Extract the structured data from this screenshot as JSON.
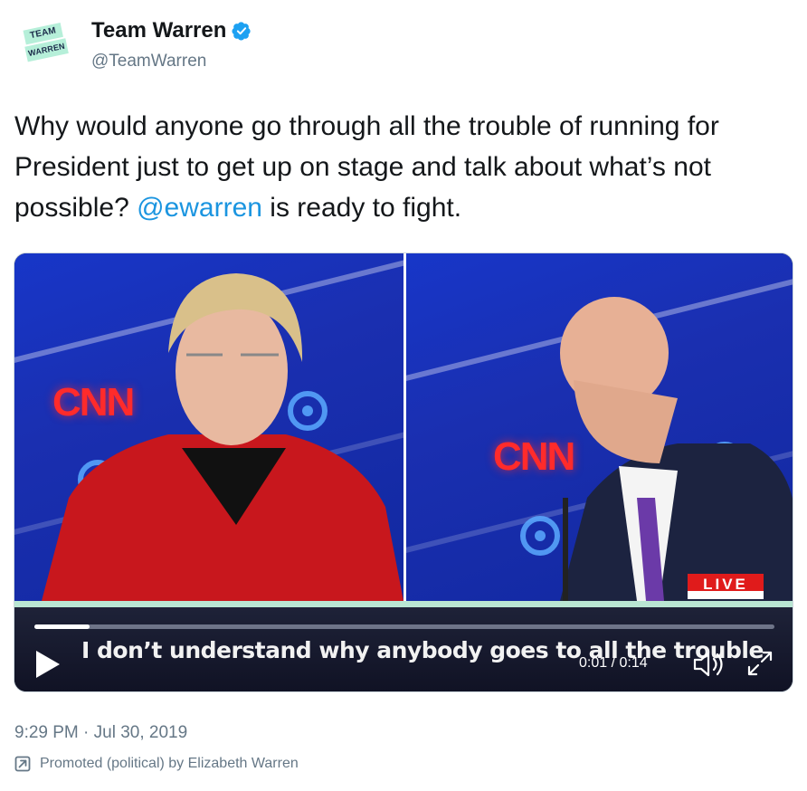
{
  "author": {
    "avatar_text_line1": "TEAM",
    "avatar_text_line2": "WARREN",
    "display_name": "Team Warren",
    "handle": "@TeamWarren",
    "verified_icon": "verified-badge-icon",
    "accent_color": "#1da1f2"
  },
  "tweet": {
    "text_before": "Why would anyone go through all the trouble of running for President just to get up on stage and talk about what’s not possible? ",
    "mention": "@ewarren",
    "text_after": " is ready to fight.",
    "mention_color": "#1b95e0"
  },
  "media": {
    "left_logo": "CNN",
    "right_logo": "CNN",
    "live_label": "LIVE",
    "caption": "I don’t understand why anybody goes to all the trouble",
    "time": "0:01 / 0:14",
    "progress": 0.075,
    "play_icon": "play-icon",
    "volume_icon": "volume-icon",
    "fullscreen_icon": "fullscreen-icon"
  },
  "footer": {
    "timestamp": "9:29 PM · Jul 30, 2019",
    "promoted_text": "Promoted (political) by Elizabeth Warren",
    "promoted_icon": "promoted-arrow-icon"
  }
}
